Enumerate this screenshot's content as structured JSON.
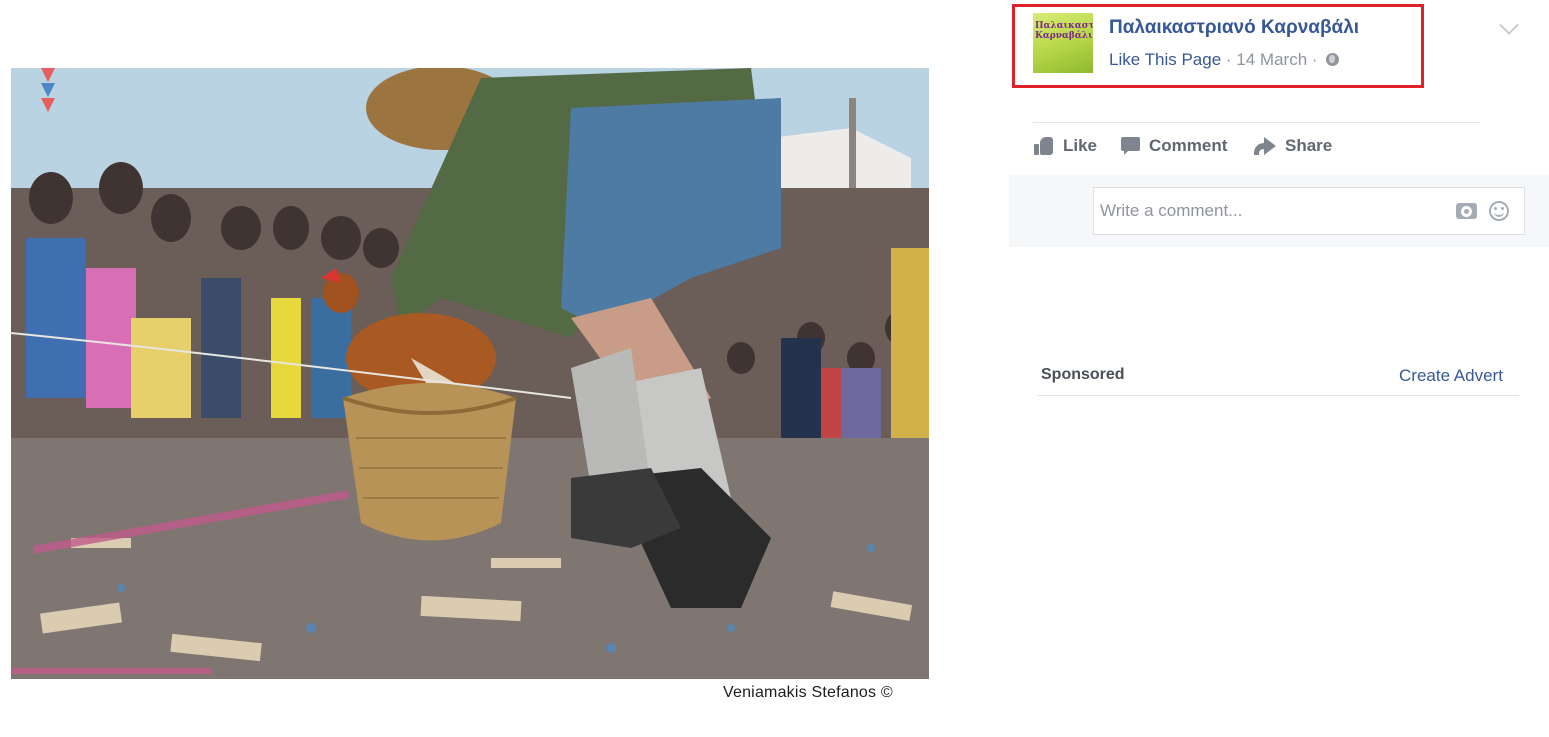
{
  "photo": {
    "description_icon": "carnival-photo",
    "credit": "Veniamakis Stefanos ©"
  },
  "post": {
    "page_name": "Παλαικαστριανό Καρναβάλι",
    "avatar_text": "Παλαικαστριανό Καρναβάλι",
    "like_page": "Like This Page",
    "separator": "·",
    "date": "14 March",
    "privacy_icon": "globe-icon",
    "menu_icon": "chevron-down-icon",
    "highlight_color": "#e02128",
    "link_color": "#365899"
  },
  "actions": {
    "like": "Like",
    "comment": "Comment",
    "share": "Share"
  },
  "comment_box": {
    "placeholder": "Write a comment..."
  },
  "sidebar": {
    "sponsored": "Sponsored",
    "create_advert": "Create Advert"
  }
}
